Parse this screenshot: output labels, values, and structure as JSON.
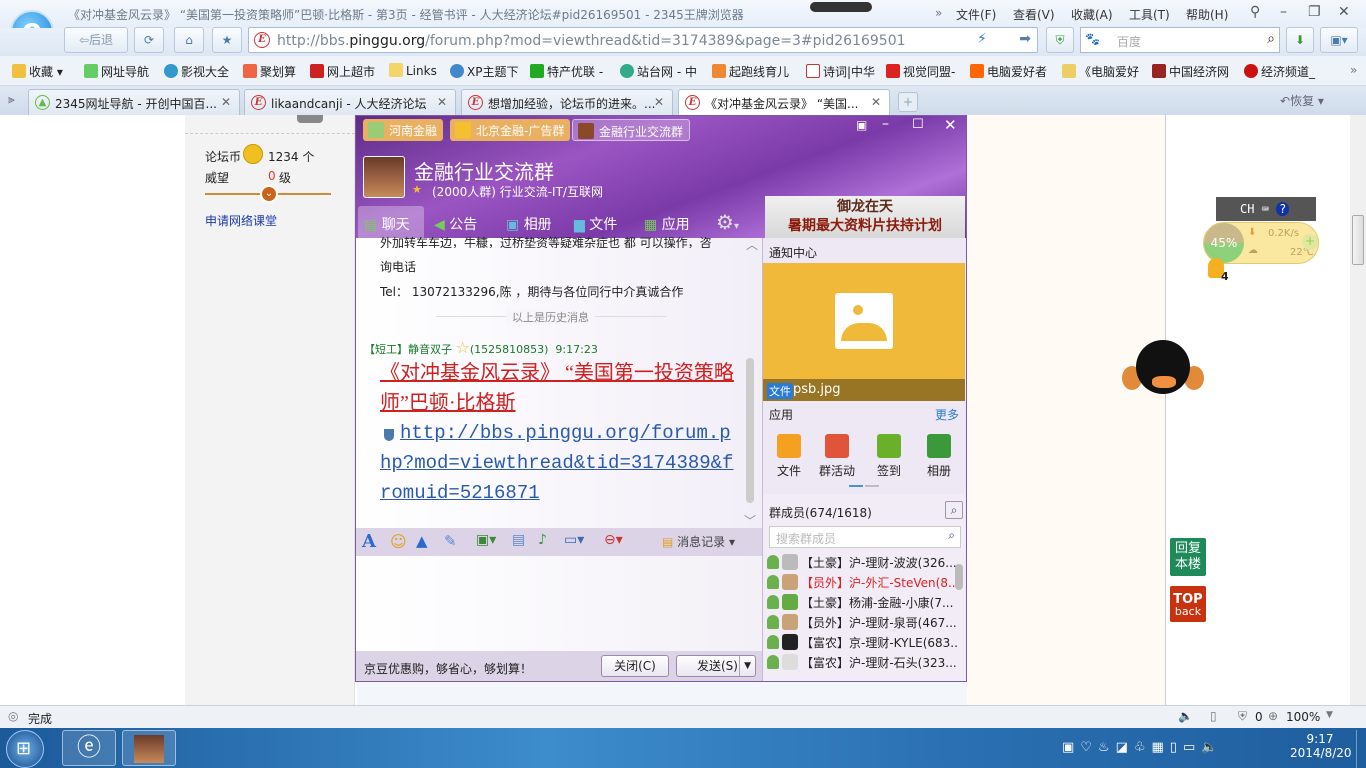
{
  "browser": {
    "title": "《对冲基金风云录》 “美国第一投资策略师”巴顿·比格斯 - 第3页 - 经管书评 - 人大经济论坛#pid26169501 - 2345王牌浏览器",
    "menu": [
      "文件(F)",
      "查看(V)",
      "收藏(A)",
      "工具(T)",
      "帮助(H)"
    ],
    "back_label": "后退",
    "url_prefix": "http://bbs.",
    "url_domain": "pinggu.org",
    "url_suffix": "/forum.php?mod=viewthread&tid=3174389&page=3#pid26169501",
    "search_placeholder": "百度",
    "bookmarks": [
      "收藏",
      "网址导航",
      "影视大全",
      "聚划算",
      "网上超市",
      "Links",
      "XP主题下",
      "特产优联 -",
      "站台网 - 中",
      "起跑线育儿",
      "诗词|中华",
      "视觉同盟-",
      "电脑爱好者",
      "《电脑爱好",
      "中国经济网",
      "经济频道_"
    ],
    "tabs": [
      "2345网址导航 - 开创中国百...",
      "likaandcanji - 人大经济论坛",
      "想增加经验，论坛币的进来。...",
      "《对冲基金风云录》 “美国..."
    ],
    "restore_label": "恢复"
  },
  "forum_sidebar": {
    "coins_label": "论坛币",
    "coins_value": "1234 个",
    "prestige_label": "威望",
    "prestige_value": "0",
    "prestige_unit": "级",
    "link": "申请网络课堂"
  },
  "qq": {
    "tabs": [
      "河南金融",
      "北京金融-广告群",
      "金融行业交流群"
    ],
    "group_name": "金融行业交流群",
    "group_info": "(2000人群) 行业交流-IT/互联网",
    "nav": [
      "聊天",
      "公告",
      "相册",
      "文件",
      "应用"
    ],
    "ad_line1": "御龙在天",
    "ad_line2": "暑期最大资料片扶持计划",
    "chat": {
      "partial_line": "外加转车车边，牛糠，过桥垫资等疑难杂症也 都 可以操作，咨",
      "line2": "询电话",
      "line3": "Tel： 13072133296,陈 ，期待与各位同行中介真诚合作",
      "history_divider": "以上是历史消息",
      "sender_tag": "【短工】",
      "sender_name": "静音双子",
      "sender_id": "(1525810853)",
      "time": "9:17:23",
      "msg_title": "《对冲基金风云录》 “美国第一投资策略师”巴顿·比格斯",
      "msg_link": "http://bbs.pinggu.org/forum.php?mod=viewthread&tid=3174389&fromuid=5216871"
    },
    "history_button": "消息记录",
    "ad_text": "京豆优惠购，够省心，够划算！",
    "close_button": "关闭(C)",
    "send_button": "发送(S)",
    "notice_title": "通知中心",
    "file_tag": "文件",
    "file_name": "psb.jpg",
    "apps_title": "应用",
    "apps_more": "更多",
    "apps": [
      "文件",
      "群活动",
      "签到",
      "相册"
    ],
    "members_title": "群成员(674/1618)",
    "member_search_placeholder": "搜索群成员",
    "members": [
      {
        "tag": "【土豪】",
        "name": "沪-理财-波波(326...",
        "color": "#222"
      },
      {
        "tag": "【员外】",
        "name": "沪-外汇-SteVen(8...",
        "color": "#e02020"
      },
      {
        "tag": "【土豪】",
        "name": "杨浦-金融-小康(7...",
        "color": "#222"
      },
      {
        "tag": "【员外】",
        "name": "沪-理财-泉哥(467...",
        "color": "#222"
      },
      {
        "tag": "【富农】",
        "name": "京-理财-KYLE(683...",
        "color": "#222"
      },
      {
        "tag": "【富农】",
        "name": "沪-理财-石头(323...",
        "color": "#222"
      }
    ]
  },
  "widgets": {
    "ime": "CH",
    "meter_percent": "45%",
    "net_speed": "0.2K/s",
    "temperature": "22℃",
    "bulb_count": "4",
    "reply_label": "回复本楼",
    "top_label1": "TOP",
    "top_label2": "back"
  },
  "status": {
    "text": "完成",
    "shield_count": "0",
    "zoom": "100%"
  },
  "taskbar": {
    "time": "9:17",
    "date": "2014/8/20"
  }
}
